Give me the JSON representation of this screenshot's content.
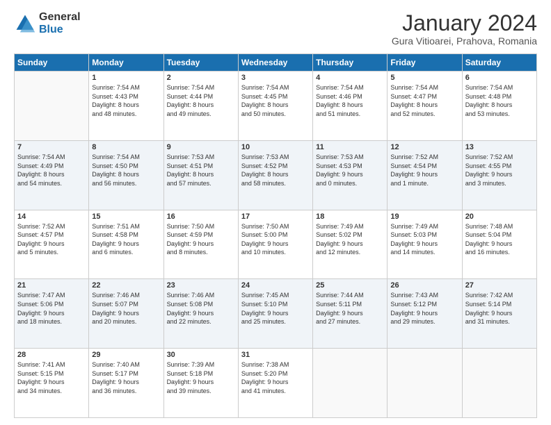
{
  "logo": {
    "general": "General",
    "blue": "Blue"
  },
  "header": {
    "month": "January 2024",
    "location": "Gura Vitioarei, Prahova, Romania"
  },
  "weekdays": [
    "Sunday",
    "Monday",
    "Tuesday",
    "Wednesday",
    "Thursday",
    "Friday",
    "Saturday"
  ],
  "weeks": [
    [
      {
        "day": "",
        "info": ""
      },
      {
        "day": "1",
        "info": "Sunrise: 7:54 AM\nSunset: 4:43 PM\nDaylight: 8 hours\nand 48 minutes."
      },
      {
        "day": "2",
        "info": "Sunrise: 7:54 AM\nSunset: 4:44 PM\nDaylight: 8 hours\nand 49 minutes."
      },
      {
        "day": "3",
        "info": "Sunrise: 7:54 AM\nSunset: 4:45 PM\nDaylight: 8 hours\nand 50 minutes."
      },
      {
        "day": "4",
        "info": "Sunrise: 7:54 AM\nSunset: 4:46 PM\nDaylight: 8 hours\nand 51 minutes."
      },
      {
        "day": "5",
        "info": "Sunrise: 7:54 AM\nSunset: 4:47 PM\nDaylight: 8 hours\nand 52 minutes."
      },
      {
        "day": "6",
        "info": "Sunrise: 7:54 AM\nSunset: 4:48 PM\nDaylight: 8 hours\nand 53 minutes."
      }
    ],
    [
      {
        "day": "7",
        "info": "Sunrise: 7:54 AM\nSunset: 4:49 PM\nDaylight: 8 hours\nand 54 minutes."
      },
      {
        "day": "8",
        "info": "Sunrise: 7:54 AM\nSunset: 4:50 PM\nDaylight: 8 hours\nand 56 minutes."
      },
      {
        "day": "9",
        "info": "Sunrise: 7:53 AM\nSunset: 4:51 PM\nDaylight: 8 hours\nand 57 minutes."
      },
      {
        "day": "10",
        "info": "Sunrise: 7:53 AM\nSunset: 4:52 PM\nDaylight: 8 hours\nand 58 minutes."
      },
      {
        "day": "11",
        "info": "Sunrise: 7:53 AM\nSunset: 4:53 PM\nDaylight: 9 hours\nand 0 minutes."
      },
      {
        "day": "12",
        "info": "Sunrise: 7:52 AM\nSunset: 4:54 PM\nDaylight: 9 hours\nand 1 minute."
      },
      {
        "day": "13",
        "info": "Sunrise: 7:52 AM\nSunset: 4:55 PM\nDaylight: 9 hours\nand 3 minutes."
      }
    ],
    [
      {
        "day": "14",
        "info": "Sunrise: 7:52 AM\nSunset: 4:57 PM\nDaylight: 9 hours\nand 5 minutes."
      },
      {
        "day": "15",
        "info": "Sunrise: 7:51 AM\nSunset: 4:58 PM\nDaylight: 9 hours\nand 6 minutes."
      },
      {
        "day": "16",
        "info": "Sunrise: 7:50 AM\nSunset: 4:59 PM\nDaylight: 9 hours\nand 8 minutes."
      },
      {
        "day": "17",
        "info": "Sunrise: 7:50 AM\nSunset: 5:00 PM\nDaylight: 9 hours\nand 10 minutes."
      },
      {
        "day": "18",
        "info": "Sunrise: 7:49 AM\nSunset: 5:02 PM\nDaylight: 9 hours\nand 12 minutes."
      },
      {
        "day": "19",
        "info": "Sunrise: 7:49 AM\nSunset: 5:03 PM\nDaylight: 9 hours\nand 14 minutes."
      },
      {
        "day": "20",
        "info": "Sunrise: 7:48 AM\nSunset: 5:04 PM\nDaylight: 9 hours\nand 16 minutes."
      }
    ],
    [
      {
        "day": "21",
        "info": "Sunrise: 7:47 AM\nSunset: 5:06 PM\nDaylight: 9 hours\nand 18 minutes."
      },
      {
        "day": "22",
        "info": "Sunrise: 7:46 AM\nSunset: 5:07 PM\nDaylight: 9 hours\nand 20 minutes."
      },
      {
        "day": "23",
        "info": "Sunrise: 7:46 AM\nSunset: 5:08 PM\nDaylight: 9 hours\nand 22 minutes."
      },
      {
        "day": "24",
        "info": "Sunrise: 7:45 AM\nSunset: 5:10 PM\nDaylight: 9 hours\nand 25 minutes."
      },
      {
        "day": "25",
        "info": "Sunrise: 7:44 AM\nSunset: 5:11 PM\nDaylight: 9 hours\nand 27 minutes."
      },
      {
        "day": "26",
        "info": "Sunrise: 7:43 AM\nSunset: 5:12 PM\nDaylight: 9 hours\nand 29 minutes."
      },
      {
        "day": "27",
        "info": "Sunrise: 7:42 AM\nSunset: 5:14 PM\nDaylight: 9 hours\nand 31 minutes."
      }
    ],
    [
      {
        "day": "28",
        "info": "Sunrise: 7:41 AM\nSunset: 5:15 PM\nDaylight: 9 hours\nand 34 minutes."
      },
      {
        "day": "29",
        "info": "Sunrise: 7:40 AM\nSunset: 5:17 PM\nDaylight: 9 hours\nand 36 minutes."
      },
      {
        "day": "30",
        "info": "Sunrise: 7:39 AM\nSunset: 5:18 PM\nDaylight: 9 hours\nand 39 minutes."
      },
      {
        "day": "31",
        "info": "Sunrise: 7:38 AM\nSunset: 5:20 PM\nDaylight: 9 hours\nand 41 minutes."
      },
      {
        "day": "",
        "info": ""
      },
      {
        "day": "",
        "info": ""
      },
      {
        "day": "",
        "info": ""
      }
    ]
  ]
}
